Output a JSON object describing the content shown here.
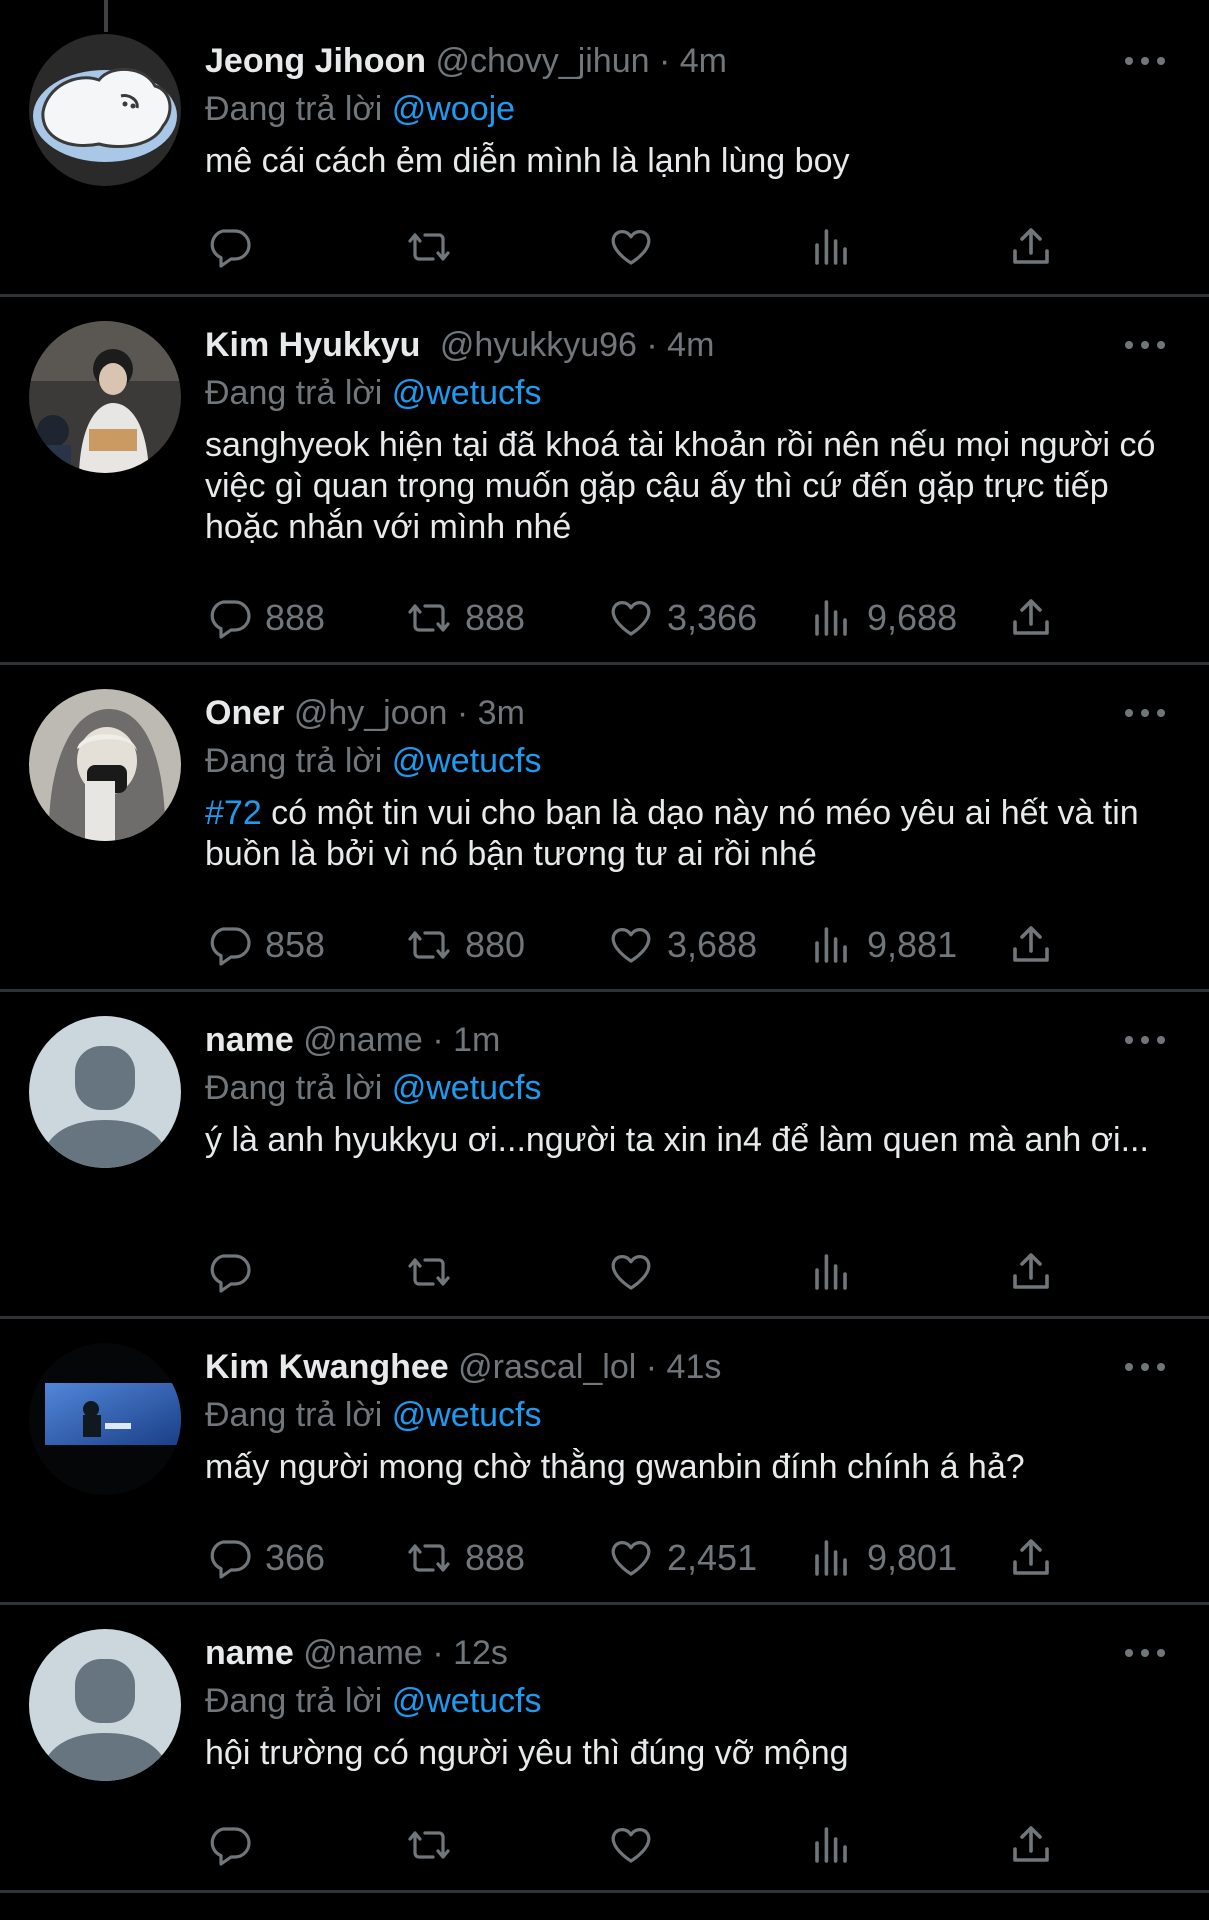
{
  "reply_prefix": "Đang trả lời",
  "tweets": [
    {
      "name": "Jeong Jihoon",
      "handle": "@chovy_jihun",
      "time": "4m",
      "reply_to": "@wooje",
      "hashtag": "",
      "text": "mê cái cách ẻm diễn mình là lạnh lùng boy",
      "replies": "",
      "retweets": "",
      "likes": "",
      "views": "",
      "avatar": "cartoon-egg-avatar"
    },
    {
      "name": "Kim Hyukkyu",
      "handle": "@hyukkyu96",
      "time": "4m",
      "reply_to": "@wetucfs",
      "hashtag": "",
      "text": "sanghyeok hiện tại đã khoá tài khoản rồi nên nếu mọi người có việc gì quan trọng muốn gặp cậu ấy thì cứ đến gặp trực tiếp hoặc nhắn với mình nhé",
      "replies": "888",
      "retweets": "888",
      "likes": "3,366",
      "views": "9,688",
      "avatar": "photo-avatar"
    },
    {
      "name": "Oner",
      "handle": "@hy_joon",
      "time": "3m",
      "reply_to": "@wetucfs",
      "hashtag": "#72",
      "text": " có một tin vui cho bạn là dạo này nó méo yêu ai hết và tin buồn là bởi vì nó bận tương tư ai rồi nhé",
      "replies": "858",
      "retweets": "880",
      "likes": "3,688",
      "views": "9,881",
      "avatar": "photo-avatar"
    },
    {
      "name": "name",
      "handle": "@name",
      "time": "1m",
      "reply_to": "@wetucfs",
      "hashtag": "",
      "text": "ý là anh hyukkyu ơi...người ta xin in4 để làm quen mà anh ơi...",
      "replies": "",
      "retweets": "",
      "likes": "",
      "views": "",
      "avatar": "default-avatar"
    },
    {
      "name": "Kim Kwanghee",
      "handle": "@rascal_lol",
      "time": "41s",
      "reply_to": "@wetucfs",
      "hashtag": "",
      "text": "mấy người mong chờ thằng gwanbin đính chính á hả?",
      "replies": "366",
      "retweets": "888",
      "likes": "2,451",
      "views": "9,801",
      "avatar": "stage-photo-avatar"
    },
    {
      "name": "name",
      "handle": "@name",
      "time": "12s",
      "reply_to": "@wetucfs",
      "hashtag": "",
      "text": "hội trường có người yêu thì đúng vỡ mộng",
      "replies": "",
      "retweets": "",
      "likes": "",
      "views": "",
      "avatar": "default-avatar"
    }
  ],
  "colors": {
    "background": "#000000",
    "text": "#e7e9ea",
    "muted": "#71767b",
    "accent": "#1d9bf0",
    "divider": "#2f3336"
  }
}
